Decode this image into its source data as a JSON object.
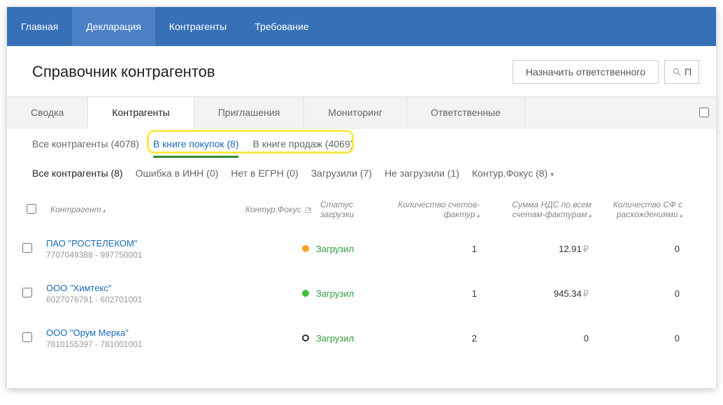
{
  "nav": {
    "items": [
      {
        "label": "Главная"
      },
      {
        "label": "Декларация"
      },
      {
        "label": "Контрагенты"
      },
      {
        "label": "Требование"
      }
    ],
    "active_index": 1
  },
  "header": {
    "title": "Справочник контрагентов",
    "assign_button": "Назначить ответственного",
    "search_placeholder": "П"
  },
  "tabs": {
    "items": [
      {
        "label": "Сводка"
      },
      {
        "label": "Контрагенты"
      },
      {
        "label": "Приглашения"
      },
      {
        "label": "Мониторинг"
      },
      {
        "label": "Ответственные"
      }
    ],
    "active_index": 1
  },
  "subfilters": {
    "items": [
      {
        "label": "Все контрагенты (4078)"
      },
      {
        "label": "В книге покупок (8)"
      },
      {
        "label": "В книге продаж (4069)"
      }
    ],
    "active_index": 1
  },
  "subfilters2": {
    "items": [
      {
        "label": "Все контрагенты (8)"
      },
      {
        "label": "Ошибка в ИНН (0)"
      },
      {
        "label": "Нет в ЕГРН (0)"
      },
      {
        "label": "Загрузили (7)"
      },
      {
        "label": "Не загрузили (1)"
      },
      {
        "label": "Контур.Фокус (8)",
        "dropdown": true
      }
    ],
    "active_index": 0
  },
  "table": {
    "columns": {
      "contragent": "Контрагент",
      "focus": "Контур.Фокус",
      "status": "Статус загрузки",
      "count": "Количество счетов-фактур",
      "sum": "Сумма НДС по всем счетам-фактурам",
      "diff": "Количество СФ с расхождениями"
    },
    "rows": [
      {
        "name": "ПАО \"РОСТЕЛЕКОМ\"",
        "inn": "7707049388 - 997750001",
        "dot": "orange",
        "status": "Загрузил",
        "count": "1",
        "sum": "12.91",
        "diff": "0"
      },
      {
        "name": "ООО \"Химтекс\"",
        "inn": "6027076791 - 602701001",
        "dot": "green",
        "status": "Загрузил",
        "count": "1",
        "sum": "945.34",
        "diff": "0"
      },
      {
        "name": "ООО \"Орум Мерка\"",
        "inn": "7810155397 - 781001001",
        "dot": "ring",
        "status": "Загрузил",
        "count": "2",
        "sum": "0",
        "diff": "0"
      }
    ],
    "currency": "₽"
  }
}
